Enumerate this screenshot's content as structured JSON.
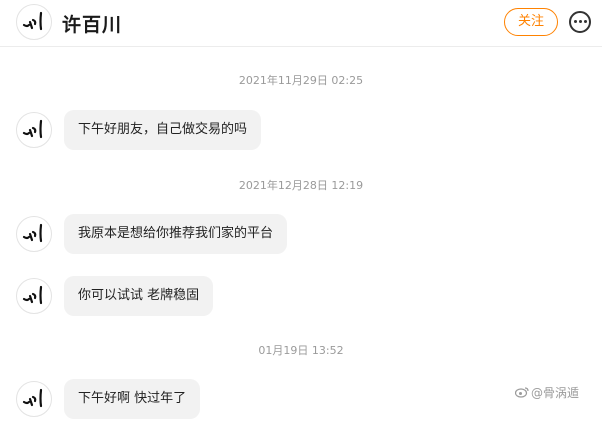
{
  "header": {
    "title": "许百川",
    "follow_label": "关注",
    "more_icon": "more-circle-icon",
    "accent_color": "#ff8200"
  },
  "messages": [
    {
      "timestamp": "2021年11月29日 02:25",
      "text": "下午好朋友，自己做交易的吗"
    },
    {
      "timestamp": "2021年12月28日 12:19",
      "text": "我原本是想给你推荐我们家的平台"
    },
    {
      "timestamp": "",
      "text": "你可以试试 老牌稳固"
    },
    {
      "timestamp": "01月19日 13:52",
      "text": "下午好啊 快过年了"
    }
  ],
  "watermark": {
    "text": "@骨涡遁"
  },
  "colors": {
    "bubble": "#f2f2f2",
    "timestamp": "#9a9a9a"
  }
}
